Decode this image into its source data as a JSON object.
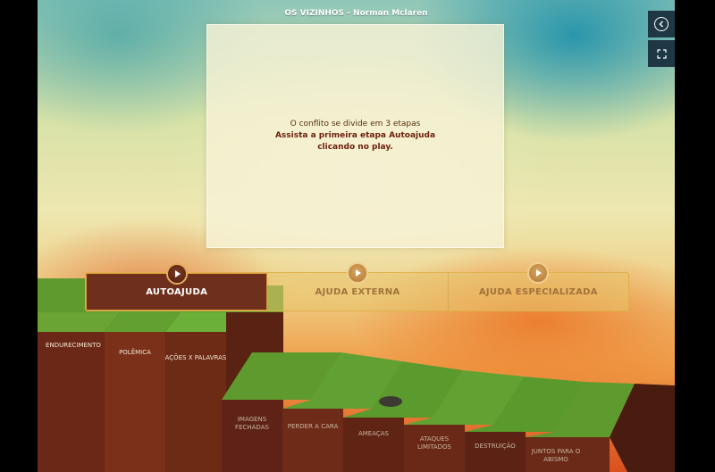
{
  "header": {
    "title": "OS VIZINHOS - Norman Mclaren"
  },
  "side_buttons": {
    "back_icon": "back-arrow-icon",
    "expand_icon": "expand-icon"
  },
  "video": {
    "line1": "O conflito se divide em 3 etapas",
    "line2": "Assista a primeira etapa Autoajuda",
    "line3": "clicando no play."
  },
  "tabs": [
    {
      "label": "AUTOAJUDA",
      "active": true
    },
    {
      "label": "AJUDA EXTERNA",
      "active": false
    },
    {
      "label": "AJUDA ESPECIALIZADA",
      "active": false
    }
  ],
  "steps": [
    "ENDURECIMENTO",
    "POLÊMICA",
    "AÇÕES x PALAVRAS",
    "IMAGENS FECHADAS",
    "PERDER A CARA",
    "AMEAÇAS",
    "ATAQUES LIMITADOS",
    "DESTRUIÇÃO",
    "JUNTOS PARA O ABISMO"
  ],
  "colors": {
    "accent": "#6e2f1c",
    "gold": "#e0b04a",
    "grass": "#5e9a2e",
    "soil": "#6a2a17"
  }
}
